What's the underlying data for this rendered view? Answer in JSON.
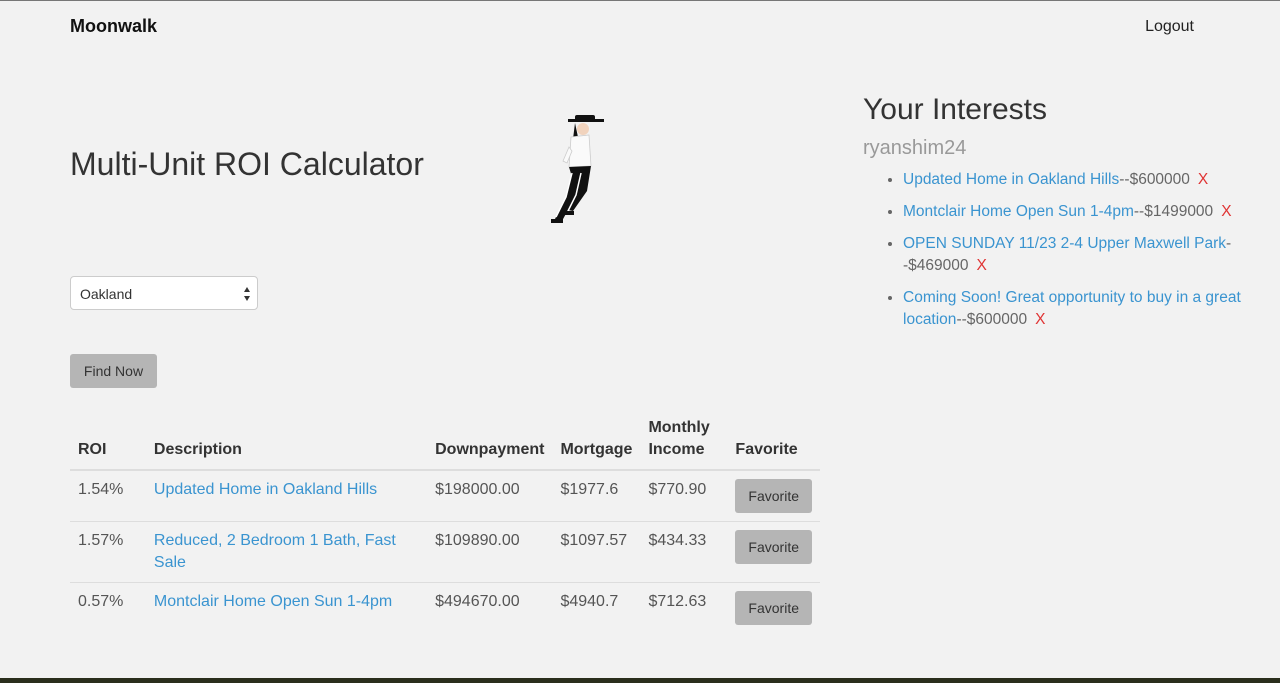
{
  "navbar": {
    "brand": "Moonwalk",
    "logout": "Logout"
  },
  "main": {
    "title": "Multi-Unit ROI Calculator",
    "city_select": {
      "value": "Oakland"
    },
    "find_button": "Find Now"
  },
  "table": {
    "headers": {
      "roi": "ROI",
      "description": "Description",
      "downpayment": "Downpayment",
      "mortgage": "Mortgage",
      "income_line1": "Monthly",
      "income_line2": "Income",
      "favorite": "Favorite"
    },
    "rows": [
      {
        "roi": "1.54%",
        "description": "Updated Home in Oakland Hills",
        "downpayment": "$198000.00",
        "mortgage": "$1977.6",
        "income": "$770.90",
        "favorite": "Favorite"
      },
      {
        "roi": "1.57%",
        "description": "Reduced, 2 Bedroom 1 Bath, Fast Sale",
        "downpayment": "$109890.00",
        "mortgage": "$1097.57",
        "income": "$434.33",
        "favorite": "Favorite"
      },
      {
        "roi": "0.57%",
        "description": "Montclair Home Open Sun 1-4pm",
        "downpayment": "$494670.00",
        "mortgage": "$4940.7",
        "income": "$712.63",
        "favorite": "Favorite"
      }
    ]
  },
  "interests": {
    "title": "Your Interests",
    "username": "ryanshim24",
    "items": [
      {
        "title": "Updated Home in Oakland Hills",
        "price": "--$600000",
        "remove": "X"
      },
      {
        "title": "Montclair Home Open Sun 1-4pm",
        "price": "--$1499000",
        "remove": "X"
      },
      {
        "title": "OPEN SUNDAY 11/23 2-4 Upper Maxwell Park",
        "price": "--$469000",
        "remove": "X"
      },
      {
        "title": "Coming Soon! Great opportunity to buy in a great location",
        "price": "--$600000",
        "remove": "X"
      }
    ]
  },
  "colors": {
    "link": "#3a94d0",
    "remove": "#e03434",
    "button": "#b5b5b5"
  },
  "icons": {
    "mascot": "moonwalk-dancer-icon",
    "select_arrows": "select-arrows-icon"
  }
}
